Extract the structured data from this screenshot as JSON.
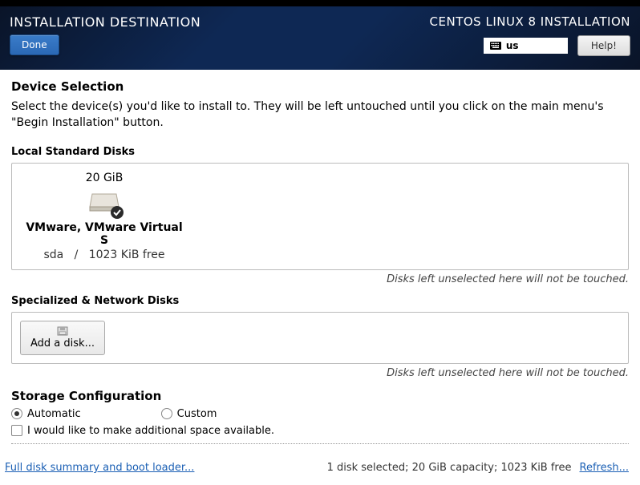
{
  "header": {
    "page_title": "INSTALLATION DESTINATION",
    "done_label": "Done",
    "install_title": "CENTOS LINUX 8 INSTALLATION",
    "keyboard_layout": "us",
    "help_label": "Help!"
  },
  "device_selection": {
    "title": "Device Selection",
    "description": "Select the device(s) you'd like to install to.  They will be left untouched until you click on the main menu's \"Begin Installation\" button."
  },
  "local_disks": {
    "label": "Local Standard Disks",
    "disks": [
      {
        "size": "20 GiB",
        "name": "VMware, VMware Virtual S",
        "device": "sda",
        "sep": "/",
        "free": "1023 KiB free",
        "selected": true
      }
    ],
    "hint": "Disks left unselected here will not be touched."
  },
  "network_disks": {
    "label": "Specialized & Network Disks",
    "add_label": "Add a disk...",
    "hint": "Disks left unselected here will not be touched."
  },
  "storage": {
    "title": "Storage Configuration",
    "radio_auto": "Automatic",
    "radio_custom": "Custom",
    "checkbox_space": "I would like to make additional space available."
  },
  "footer": {
    "summary_link": "Full disk summary and boot loader...",
    "summary_text": "1 disk selected; 20 GiB capacity; 1023 KiB free",
    "refresh_link": "Refresh..."
  }
}
